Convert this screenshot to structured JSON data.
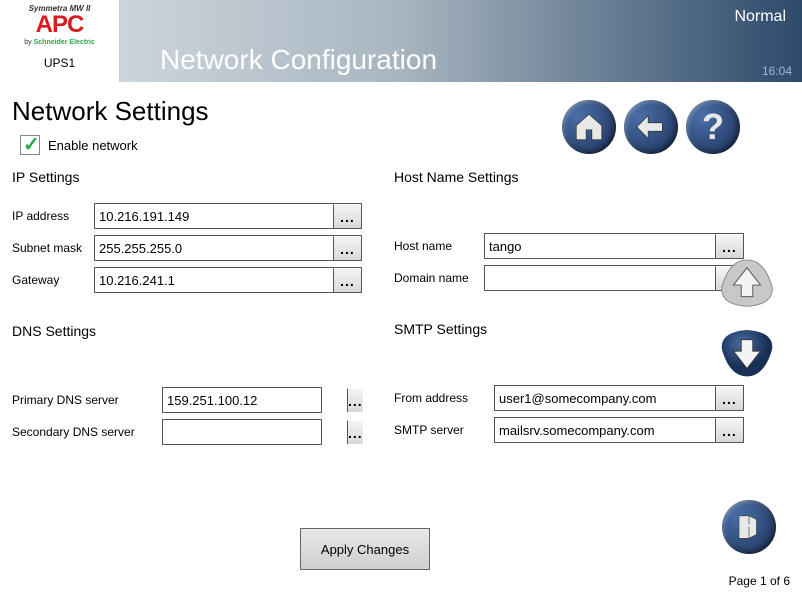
{
  "header": {
    "brand_top": "Symmetra MW II",
    "brand_main": "APC",
    "brand_sub_prefix": "by ",
    "brand_sub_green": "Schneider Electric",
    "device": "UPS1",
    "title": "Network Configuration",
    "status": "Normal",
    "time": "16:04"
  },
  "page": {
    "heading": "Network Settings",
    "enable_label": "Enable network",
    "enable_checked": true,
    "pager": "Page 1 of 6",
    "apply_label": "Apply Changes"
  },
  "ip": {
    "heading": "IP Settings",
    "rows": [
      {
        "label": "IP address",
        "value": "10.216.191.149"
      },
      {
        "label": "Subnet mask",
        "value": "255.255.255.0"
      },
      {
        "label": "Gateway",
        "value": "10.216.241.1"
      }
    ]
  },
  "host": {
    "heading": "Host Name Settings",
    "rows": [
      {
        "label": "Host name",
        "value": "tango"
      },
      {
        "label": "Domain name",
        "value": ""
      }
    ]
  },
  "dns": {
    "heading": "DNS Settings",
    "rows": [
      {
        "label": "Primary DNS server",
        "value": "159.251.100.12"
      },
      {
        "label": "Secondary DNS server",
        "value": ""
      }
    ]
  },
  "smtp": {
    "heading": "SMTP Settings",
    "rows": [
      {
        "label": "From address",
        "value": "user1@somecompany.com"
      },
      {
        "label": "SMTP server",
        "value": "mailsrv.somecompany.com"
      }
    ]
  },
  "ellipsis": "..."
}
